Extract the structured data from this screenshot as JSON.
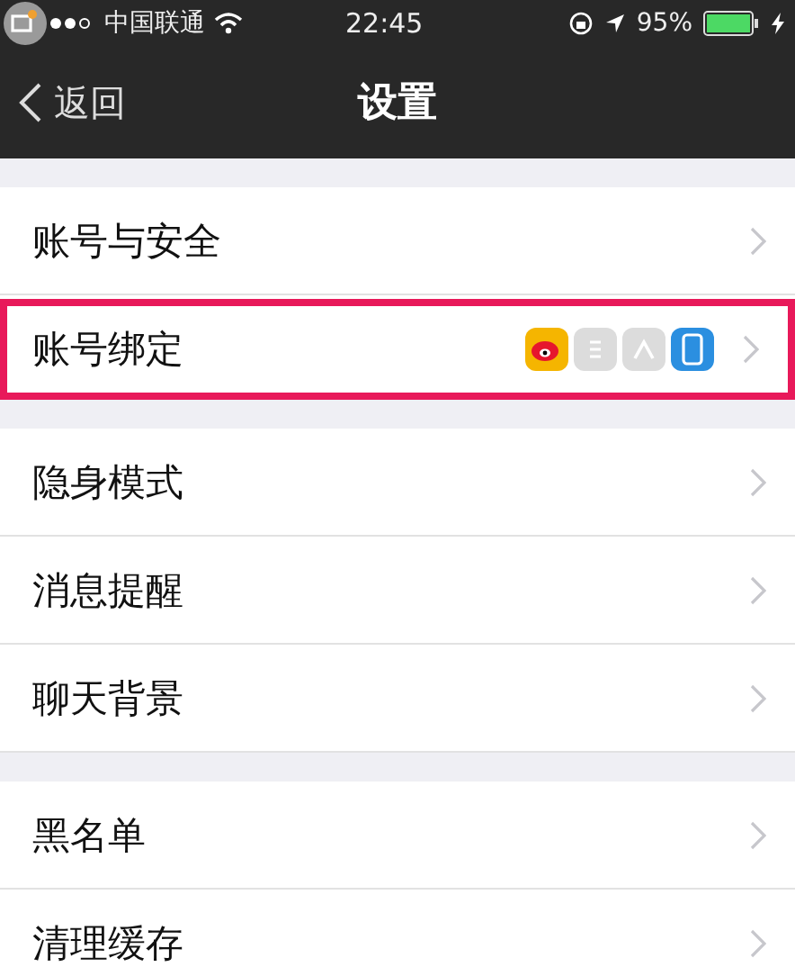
{
  "status_bar": {
    "carrier": "中国联通",
    "time": "22:45",
    "battery": "95%"
  },
  "nav": {
    "back": "返回",
    "title": "设置"
  },
  "sections": [
    {
      "rows": [
        {
          "label": "账号与安全",
          "highlighted": false
        },
        {
          "label": "账号绑定",
          "highlighted": true,
          "accounts": [
            {
              "kind": "weibo",
              "linked": true
            },
            {
              "kind": "mail",
              "linked": false
            },
            {
              "kind": "contacts",
              "linked": false
            },
            {
              "kind": "phone",
              "linked": true
            }
          ]
        }
      ]
    },
    {
      "rows": [
        {
          "label": "隐身模式",
          "highlighted": false
        },
        {
          "label": "消息提醒",
          "highlighted": false
        },
        {
          "label": "聊天背景",
          "highlighted": false
        }
      ]
    },
    {
      "rows": [
        {
          "label": "黑名单",
          "highlighted": false
        },
        {
          "label": "清理缓存",
          "highlighted": false
        }
      ]
    }
  ]
}
